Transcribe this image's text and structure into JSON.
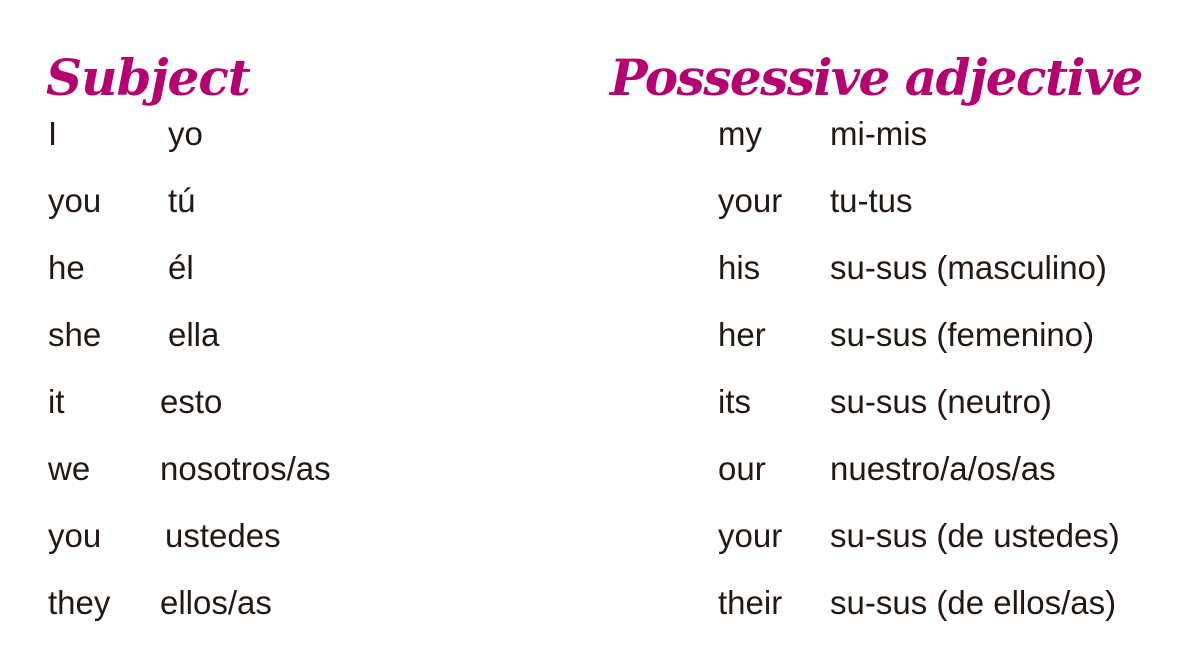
{
  "subject_section": {
    "heading": "Subject",
    "rows": [
      {
        "english": "I",
        "spanish": "yo"
      },
      {
        "english": "you",
        "spanish": "tú"
      },
      {
        "english": "he",
        "spanish": "él"
      },
      {
        "english": "she",
        "spanish": "ella"
      },
      {
        "english": "it",
        "spanish": "esto"
      },
      {
        "english": "we",
        "spanish": "nosotros/as"
      },
      {
        "english": "you",
        "spanish": "ustedes"
      },
      {
        "english": "they",
        "spanish": "ellos/as"
      }
    ]
  },
  "possessive_section": {
    "heading": "Possessive adjective",
    "rows": [
      {
        "english": "my",
        "spanish": "mi-mis"
      },
      {
        "english": "your",
        "spanish": "tu-tus"
      },
      {
        "english": "his",
        "spanish": "su-sus (masculino)"
      },
      {
        "english": "her",
        "spanish": "su-sus (femenino)"
      },
      {
        "english": "its",
        "spanish": "su-sus (neutro)"
      },
      {
        "english": "our",
        "spanish": "nuestro/a/os/as"
      },
      {
        "english": "your",
        "spanish": "su-sus (de ustedes)"
      },
      {
        "english": "their",
        "spanish": "su-sus (de ellos/as)"
      }
    ]
  },
  "colors": {
    "heading": "#b5006f",
    "text": "#231815",
    "background": "#ffffff"
  }
}
